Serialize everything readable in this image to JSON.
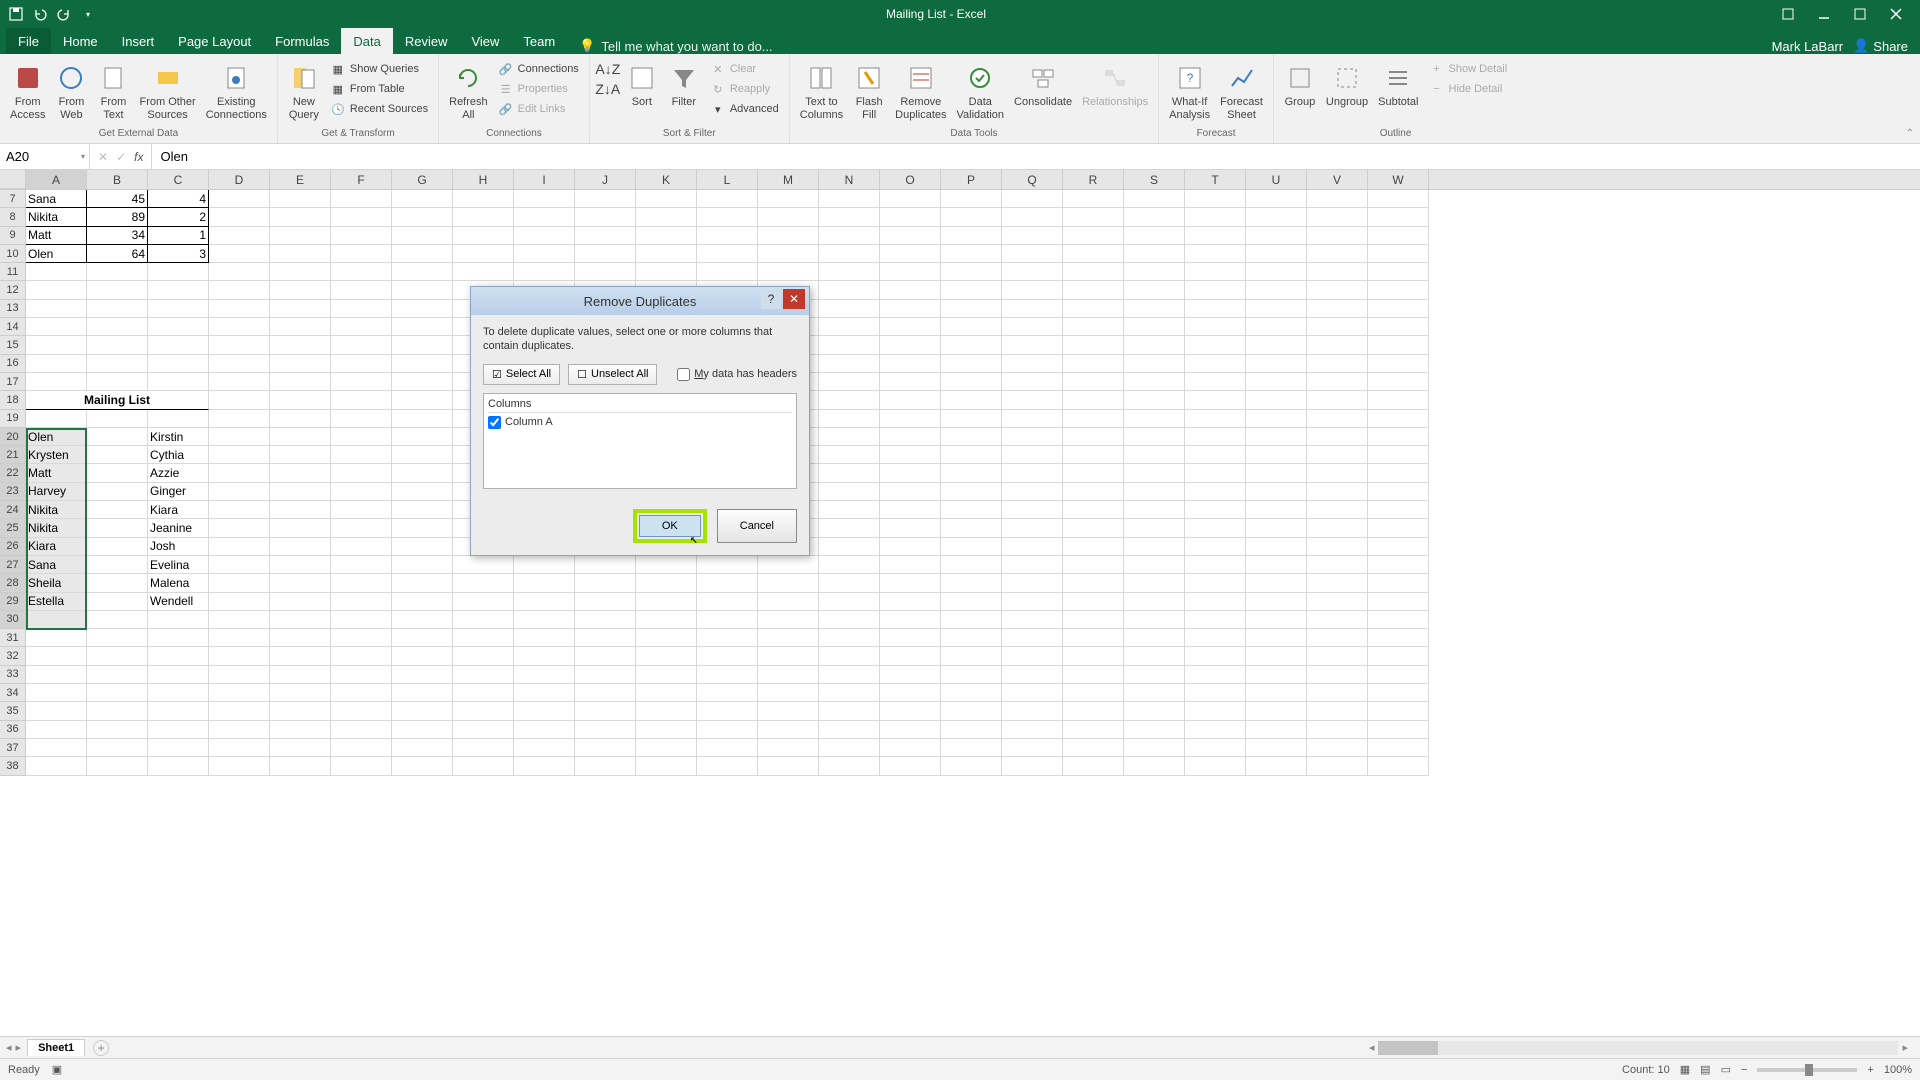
{
  "app": {
    "title": "Mailing List - Excel",
    "user": "Mark LaBarr",
    "share_label": "Share"
  },
  "tabs": {
    "file": "File",
    "items": [
      "Home",
      "Insert",
      "Page Layout",
      "Formulas",
      "Data",
      "Review",
      "View",
      "Team"
    ],
    "active": "Data",
    "tellme": "Tell me what you want to do..."
  },
  "ribbon": {
    "get_external_data": {
      "label": "Get External Data",
      "from_access": "From\nAccess",
      "from_web": "From\nWeb",
      "from_text": "From\nText",
      "from_other": "From Other\nSources",
      "existing": "Existing\nConnections"
    },
    "get_transform": {
      "label": "Get & Transform",
      "new_query": "New\nQuery",
      "show_queries": "Show Queries",
      "from_table": "From Table",
      "recent_sources": "Recent Sources"
    },
    "connections": {
      "label": "Connections",
      "refresh_all": "Refresh\nAll",
      "connections": "Connections",
      "properties": "Properties",
      "edit_links": "Edit Links"
    },
    "sort_filter": {
      "label": "Sort & Filter",
      "sort": "Sort",
      "filter": "Filter",
      "clear": "Clear",
      "reapply": "Reapply",
      "advanced": "Advanced"
    },
    "data_tools": {
      "label": "Data Tools",
      "text_to_columns": "Text to\nColumns",
      "flash_fill": "Flash\nFill",
      "remove_duplicates": "Remove\nDuplicates",
      "data_validation": "Data\nValidation",
      "consolidate": "Consolidate",
      "relationships": "Relationships"
    },
    "forecast": {
      "label": "Forecast",
      "whatif": "What-If\nAnalysis",
      "forecast_sheet": "Forecast\nSheet"
    },
    "outline": {
      "label": "Outline",
      "group": "Group",
      "ungroup": "Ungroup",
      "subtotal": "Subtotal",
      "show_detail": "Show Detail",
      "hide_detail": "Hide Detail"
    }
  },
  "name_box": "A20",
  "formula_bar": "Olen",
  "columns": [
    "A",
    "B",
    "C",
    "D",
    "E",
    "F",
    "G",
    "H",
    "I",
    "J",
    "K",
    "L",
    "M",
    "N",
    "O",
    "P",
    "Q",
    "R",
    "S",
    "T",
    "U",
    "V",
    "W"
  ],
  "row_start": 7,
  "row_end": 38,
  "cells": {
    "A7": "Sana",
    "B7": "45",
    "C7": "4",
    "A8": "Nikita",
    "B8": "89",
    "C8": "2",
    "A9": "Matt",
    "B9": "34",
    "C9": "1",
    "A10": "Olen",
    "B10": "64",
    "C10": "3",
    "A18": "",
    "B18": "Mailing List",
    "A20": "Olen",
    "C20": "Kirstin",
    "A21": "Krysten",
    "C21": "Cythia",
    "A22": "Matt",
    "C22": "Azzie",
    "A23": "Harvey",
    "C23": "Ginger",
    "A24": "Nikita",
    "C24": "Kiara",
    "A25": "Nikita",
    "C25": "Jeanine",
    "A26": "Kiara",
    "C26": "Josh",
    "A27": "Sana",
    "C27": "Evelina",
    "A28": "Sheila",
    "C28": "Malena",
    "A29": "Estella",
    "C29": "Wendell"
  },
  "mailing_list_merge_span": 3,
  "selection": {
    "col": "A",
    "rows": [
      20,
      30
    ]
  },
  "sheet": {
    "active": "Sheet1"
  },
  "status": {
    "ready": "Ready",
    "count_label": "Count:",
    "count": 10,
    "zoom": "100%"
  },
  "dialog": {
    "title": "Remove Duplicates",
    "desc": "To delete duplicate values, select one or more columns that contain duplicates.",
    "select_all": "Select All",
    "unselect_all": "Unselect All",
    "headers_label": "My data has headers",
    "columns_header": "Columns",
    "column_item": "Column A",
    "ok": "OK",
    "cancel": "Cancel"
  }
}
